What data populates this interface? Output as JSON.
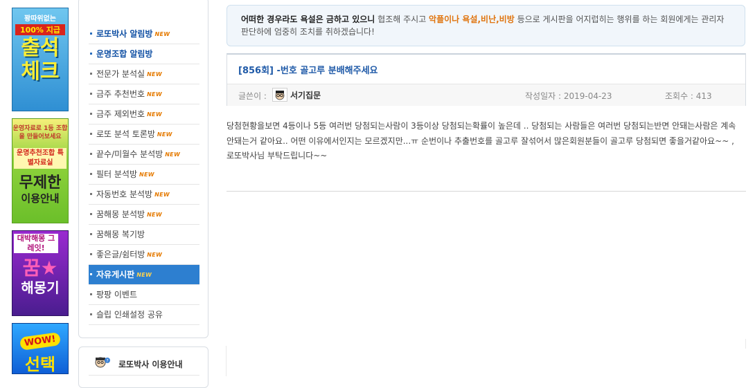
{
  "banners": {
    "attendance": {
      "line1": "꽝따위없는",
      "line2": "100% 지급",
      "line3": "출석",
      "line4": "체크"
    },
    "unlimited": {
      "line1": "운영자료로 1등 조합을 만들어보세요",
      "line2": "운명추천조합 특별자료실",
      "line3": "무제한",
      "line4": "이용안내"
    },
    "dream": {
      "line1": "대박해몽 그레잇!",
      "line2": "꿈★",
      "line3": "해몽기"
    },
    "wow": {
      "line1": "WOW!",
      "line2": "선택"
    }
  },
  "menu": {
    "new_badge": "NEW",
    "items": [
      {
        "label": "로또박사 알림방",
        "new": true
      },
      {
        "label": "운명조합 알림방",
        "new": false
      },
      {
        "label": "전문가 분석실",
        "new": true
      },
      {
        "label": "금주 추천번호",
        "new": true
      },
      {
        "label": "금주 제외번호",
        "new": true
      },
      {
        "label": "로또 분석 토론방",
        "new": true
      },
      {
        "label": "끝수/미월수 분석방",
        "new": true
      },
      {
        "label": "필터 분석방",
        "new": true
      },
      {
        "label": "자동번호 분석방",
        "new": true
      },
      {
        "label": "꿈해몽 분석방",
        "new": true
      },
      {
        "label": "꿈해몽 복기방",
        "new": false
      },
      {
        "label": "좋은글/쉼터방",
        "new": true
      },
      {
        "label": "자유게시판",
        "new": true
      },
      {
        "label": "팡팡 이벤트",
        "new": false
      },
      {
        "label": "슬립 인쇄설정 공유",
        "new": false
      }
    ]
  },
  "guide": {
    "label": "로또박사 이용안내"
  },
  "notice": {
    "part1": "어떠한 경우라도 욕설은 금하고 있으니",
    "part2": " 협조해 주시고 ",
    "part3": "악플이나 욕설,비난,비방",
    "part4": " 등으로 게시판을 어지럽히는 행위를 하는 회원에게는 관리자 판단하에 엄중히 조치를 취하겠습니다!"
  },
  "post": {
    "title": "[856회] -번호 골고루 분배해주세요",
    "author_label": "글쓴이 :",
    "author": "서기집문",
    "date_label": "작성일자 : 2019-04-23",
    "views_label": "조회수 : 413",
    "body": "당첨현황을보면 4등이나 5등 여러번 당첨되는사람이 3등이상 당첨되는확률이 높은데 .. 당첨되는 사람들은 여러번 당첨되는반면 안돼는사람은 계속 안돼는거 같아요.. 어떤 이유에서인지는 모르겠지만...ㅠ 순번이나 추출번호를 골고루 잘섞어서 많은회원분들이 골고루 당첨되면 좋을거같아요~~ ,로또박사님 부탁드립니다~~"
  }
}
